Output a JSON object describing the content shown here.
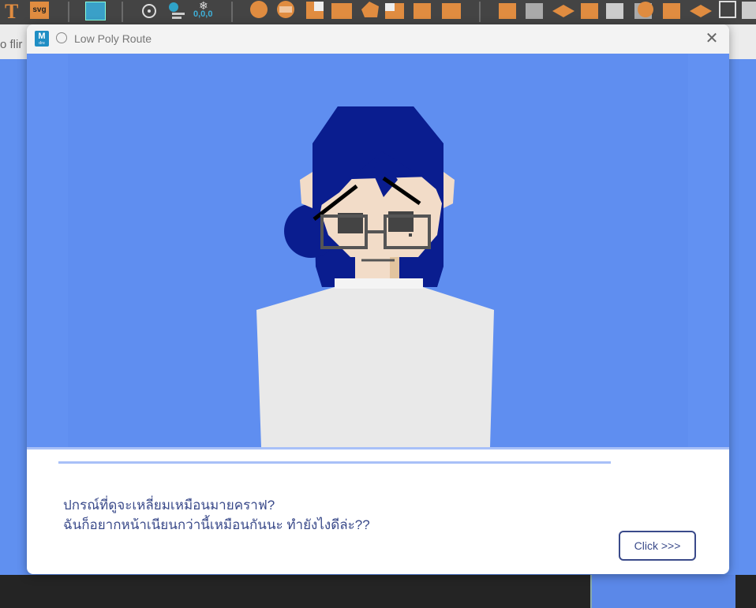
{
  "background": {
    "toolbar_text_icon": "T",
    "toolbar_svg_label": "svg",
    "toolbar_coord_label": "0,0,0",
    "strip_partial_text": "o flir"
  },
  "dialog": {
    "app_icon_letter": "M",
    "app_icon_sub": "dre",
    "title": "Low Poly Route",
    "close_label": "✕",
    "dialogue_line1": "ปกรณ์ที่ดูจะเหลี่ยมเหมือนมายคราฟ?",
    "dialogue_line2": "ฉันก็อยากหน้าเนียนกว่านี้เหมือนกันนะ ทำยังไงดีล่ะ??",
    "next_button": "Click >>>"
  },
  "colors": {
    "accent": "#3a4a8a",
    "scene_bg": "#6291f2",
    "hair": "#0a1d8f",
    "shirt": "#e9e9e9",
    "skin": "#f2dcc8"
  }
}
